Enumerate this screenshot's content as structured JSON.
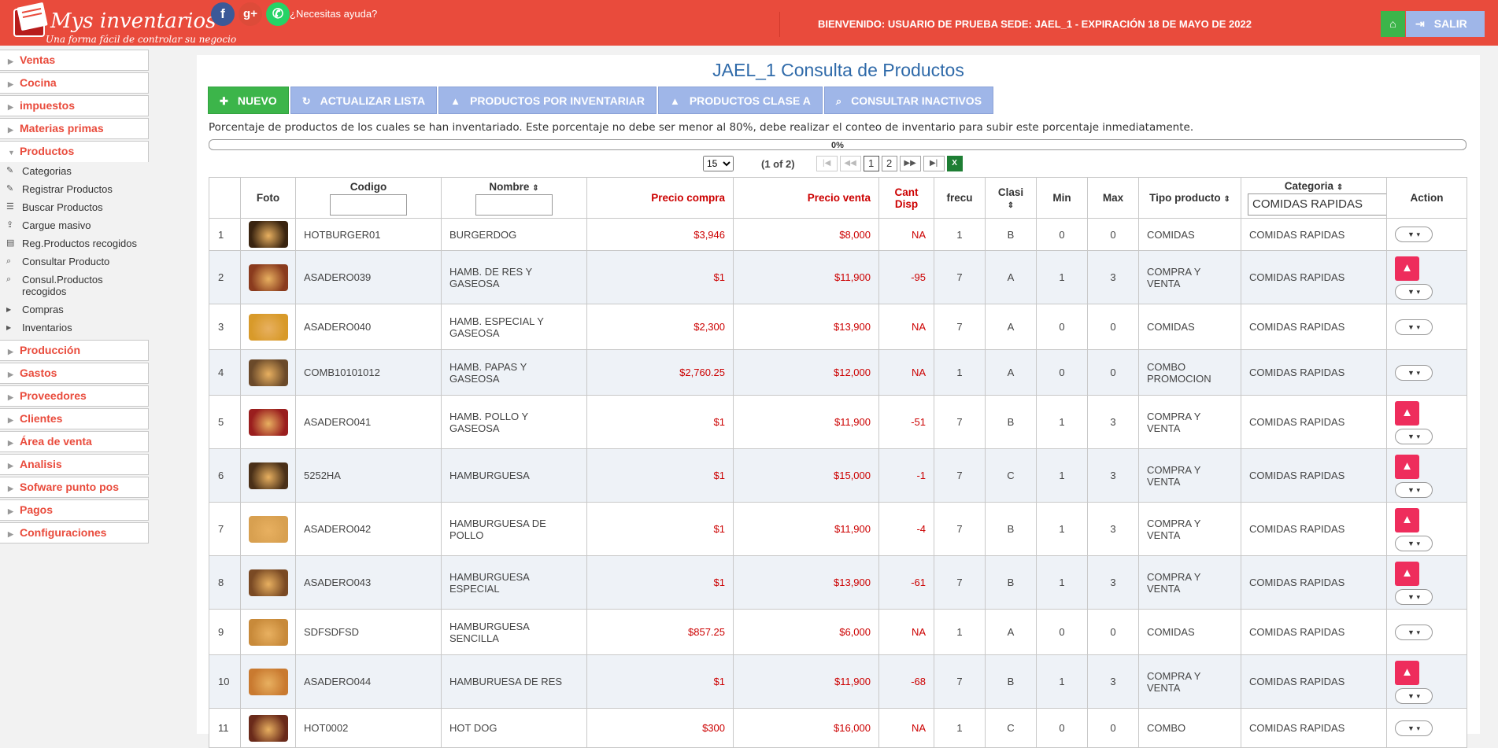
{
  "header": {
    "logo_title": "Mys inventarios",
    "logo_subtitle": "Una forma fácil de controlar su negocio",
    "help": "¿Necesitas ayuda?",
    "welcome": "BIENVENIDO:   USUARIO DE PRUEBA   SEDE: JAEL_1 - EXPIRACIÓN 18 DE MAYO DE 2022",
    "exit_label": "SALIR",
    "brand_color": "#e94b3c"
  },
  "sidebar": {
    "items_top": [
      {
        "label": "Ventas"
      },
      {
        "label": "Cocina"
      },
      {
        "label": "impuestos"
      },
      {
        "label": "Materias primas"
      }
    ],
    "open_item": {
      "label": "Productos"
    },
    "sub_items": [
      {
        "label": "Categorias",
        "icon": "pencil-icon"
      },
      {
        "label": "Registrar Productos",
        "icon": "pencil-icon"
      },
      {
        "label": "Buscar Productos",
        "icon": "database-icon"
      },
      {
        "label": "Cargue masivo",
        "icon": "upload-icon"
      },
      {
        "label": "Reg.Productos recogidos",
        "icon": "document-icon"
      },
      {
        "label": "Consultar Producto",
        "icon": "search-icon"
      },
      {
        "label": "Consul.Productos recogidos",
        "icon": "search-icon"
      },
      {
        "label": "Compras",
        "icon": "caret-icon"
      },
      {
        "label": "Inventarios",
        "icon": "caret-icon"
      }
    ],
    "items_bottom": [
      {
        "label": "Producción"
      },
      {
        "label": "Gastos"
      },
      {
        "label": "Proveedores"
      },
      {
        "label": "Clientes"
      },
      {
        "label": "Área de venta"
      },
      {
        "label": "Analisis"
      },
      {
        "label": "Sofware punto pos"
      },
      {
        "label": "Pagos"
      },
      {
        "label": "Configuraciones"
      }
    ]
  },
  "main": {
    "title": "JAEL_1 Consulta de Productos",
    "buttons": {
      "nuevo": "NUEVO",
      "actualizar": "ACTUALIZAR LISTA",
      "por_inventariar": "PRODUCTOS POR INVENTARIAR",
      "clase_a": "PRODUCTOS CLASE A",
      "inactivos": "CONSULTAR INACTIVOS"
    },
    "note": "Porcentaje de productos de los cuales se han inventariado. Este porcentaje no debe ser menor al 80%, debe realizar el conteo de inventario para subir este porcentaje inmediatamente.",
    "progress": {
      "label": "0%",
      "value": 0
    },
    "pager": {
      "rows_per_page": "15",
      "info": "(1 of 2)",
      "pages": [
        "1",
        "2"
      ]
    }
  },
  "table": {
    "headers": {
      "foto": "Foto",
      "codigo": "Codigo",
      "nombre": "Nombre",
      "precio_compra": "Precio compra",
      "precio_venta": "Precio venta",
      "cant_disp": "Cant Disp",
      "frecu": "frecu",
      "clasi": "Clasi",
      "min": "Min",
      "max": "Max",
      "tipo": "Tipo producto",
      "categoria": "Categoria",
      "action": "Action"
    },
    "categoria_filter": "COMIDAS RAPIDAS",
    "rows": [
      {
        "n": "1",
        "code": "HOTBURGER01",
        "name": "BURGERDOG",
        "buy": "$3,946",
        "sell": "$8,000",
        "qty": "NA",
        "frecu": "1",
        "clasi": "B",
        "min": "0",
        "max": "0",
        "tipo": "COMIDAS",
        "cat": "COMIDAS RAPIDAS",
        "warn": false,
        "img": "#3a2410"
      },
      {
        "n": "2",
        "code": "ASADERO039",
        "name": "HAMB. DE RES Y GASEOSA",
        "buy": "$1",
        "sell": "$11,900",
        "qty": "-95",
        "frecu": "7",
        "clasi": "A",
        "min": "1",
        "max": "3",
        "tipo": "COMPRA Y VENTA",
        "cat": "COMIDAS RAPIDAS",
        "warn": true,
        "img": "#8a3b1e"
      },
      {
        "n": "3",
        "code": "ASADERO040",
        "name": "HAMB. ESPECIAL Y GASEOSA",
        "buy": "$2,300",
        "sell": "$13,900",
        "qty": "NA",
        "frecu": "7",
        "clasi": "A",
        "min": "0",
        "max": "0",
        "tipo": "COMIDAS",
        "cat": "COMIDAS RAPIDAS",
        "warn": false,
        "img": "#d89a2a"
      },
      {
        "n": "4",
        "code": "COMB10101012",
        "name": "HAMB. PAPAS Y GASEOSA",
        "buy": "$2,760.25",
        "sell": "$12,000",
        "qty": "NA",
        "frecu": "1",
        "clasi": "A",
        "min": "0",
        "max": "0",
        "tipo": "COMBO PROMOCION",
        "cat": "COMIDAS RAPIDAS",
        "warn": false,
        "img": "#6b4a2a"
      },
      {
        "n": "5",
        "code": "ASADERO041",
        "name": "HAMB. POLLO Y GASEOSA",
        "buy": "$1",
        "sell": "$11,900",
        "qty": "-51",
        "frecu": "7",
        "clasi": "B",
        "min": "1",
        "max": "3",
        "tipo": "COMPRA Y VENTA",
        "cat": "COMIDAS RAPIDAS",
        "warn": true,
        "img": "#9a1e1e"
      },
      {
        "n": "6",
        "code": "5252HA",
        "name": "HAMBURGUESA",
        "buy": "$1",
        "sell": "$15,000",
        "qty": "-1",
        "frecu": "7",
        "clasi": "C",
        "min": "1",
        "max": "3",
        "tipo": "COMPRA Y VENTA",
        "cat": "COMIDAS RAPIDAS",
        "warn": true,
        "img": "#4a3018"
      },
      {
        "n": "7",
        "code": "ASADERO042",
        "name": "HAMBURGUESA DE POLLO",
        "buy": "$1",
        "sell": "$11,900",
        "qty": "-4",
        "frecu": "7",
        "clasi": "B",
        "min": "1",
        "max": "3",
        "tipo": "COMPRA Y VENTA",
        "cat": "COMIDAS RAPIDAS",
        "warn": true,
        "img": "#d8a050"
      },
      {
        "n": "8",
        "code": "ASADERO043",
        "name": "HAMBURGUESA ESPECIAL",
        "buy": "$1",
        "sell": "$13,900",
        "qty": "-61",
        "frecu": "7",
        "clasi": "B",
        "min": "1",
        "max": "3",
        "tipo": "COMPRA Y VENTA",
        "cat": "COMIDAS RAPIDAS",
        "warn": true,
        "img": "#7a4a24"
      },
      {
        "n": "9",
        "code": "SDFSDFSD",
        "name": "HAMBURGUESA SENCILLA",
        "buy": "$857.25",
        "sell": "$6,000",
        "qty": "NA",
        "frecu": "1",
        "clasi": "A",
        "min": "0",
        "max": "0",
        "tipo": "COMIDAS",
        "cat": "COMIDAS RAPIDAS",
        "warn": false,
        "img": "#c88a3a"
      },
      {
        "n": "10",
        "code": "ASADERO044",
        "name": "HAMBURUESA DE RES",
        "buy": "$1",
        "sell": "$11,900",
        "qty": "-68",
        "frecu": "7",
        "clasi": "B",
        "min": "1",
        "max": "3",
        "tipo": "COMPRA Y VENTA",
        "cat": "COMIDAS RAPIDAS",
        "warn": true,
        "img": "#c97a30"
      },
      {
        "n": "11",
        "code": "HOT0002",
        "name": "HOT DOG",
        "buy": "$300",
        "sell": "$16,000",
        "qty": "NA",
        "frecu": "1",
        "clasi": "C",
        "min": "0",
        "max": "0",
        "tipo": "COMBO",
        "cat": "COMIDAS RAPIDAS",
        "warn": false,
        "img": "#6a2a1a"
      }
    ]
  }
}
